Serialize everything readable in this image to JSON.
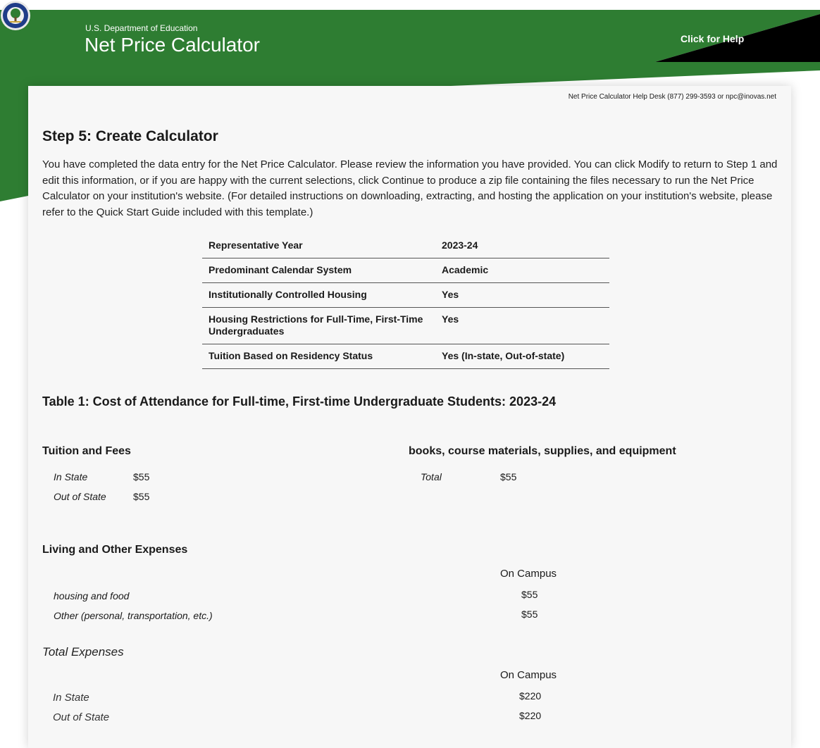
{
  "header": {
    "agency": "U.S. Department of Education",
    "title": "Net Price Calculator",
    "help_link": "Click for Help",
    "colors": {
      "banner_green": "#2e7d32",
      "accent_black": "#000000"
    },
    "seal_icon": "department-of-education-seal"
  },
  "helpdesk": "Net Price Calculator Help Desk (877) 299-3593 or npc@inovas.net",
  "step": {
    "title": "Step 5: Create Calculator",
    "intro": "You have completed the data entry for the Net Price Calculator. Please review the information you have provided. You can click Modify to return to Step 1 and edit this information, or if you are happy with the current selections, click Continue to produce a zip file containing the files necessary to run the Net Price Calculator on your institution's website. (For detailed instructions on downloading, extracting, and hosting the application on your institution's website, please refer to the Quick Start Guide included with this template.)"
  },
  "summary": [
    {
      "label": "Representative Year",
      "value": "2023-24"
    },
    {
      "label": "Predominant Calendar System",
      "value": "Academic"
    },
    {
      "label": "Institutionally Controlled Housing",
      "value": "Yes"
    },
    {
      "label": "Housing Restrictions for Full-Time, First-Time Undergraduates",
      "value": "Yes"
    },
    {
      "label": "Tuition Based on Residency Status",
      "value": "Yes (In-state, Out-of-state)"
    }
  ],
  "table1": {
    "title": "Table 1: Cost of Attendance for Full-time, First-time Undergraduate Students: 2023-24",
    "tuition": {
      "heading": "Tuition and Fees",
      "rows": [
        {
          "label": "In State",
          "value": "$55"
        },
        {
          "label": "Out of State",
          "value": "$55"
        }
      ]
    },
    "books": {
      "heading": "books, course materials, supplies, and equipment",
      "rows": [
        {
          "label": "Total",
          "value": "$55"
        }
      ]
    },
    "living": {
      "heading": "Living and Other Expenses",
      "column": "On Campus",
      "rows": [
        {
          "label": "housing and food",
          "value": "$55"
        },
        {
          "label": "Other (personal, transportation, etc.)",
          "value": "$55"
        }
      ]
    },
    "total": {
      "heading": "Total Expenses",
      "column": "On Campus",
      "rows": [
        {
          "label": "In State",
          "value": "$220"
        },
        {
          "label": "Out of State",
          "value": "$220"
        }
      ]
    }
  }
}
